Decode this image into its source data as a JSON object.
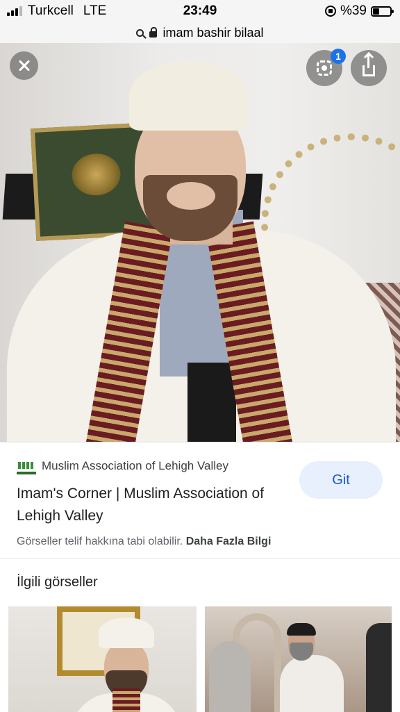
{
  "status_bar": {
    "carrier": "Turkcell",
    "network": "LTE",
    "time": "23:49",
    "battery": "%39",
    "icons": [
      "signal-icon",
      "orientation-lock-icon",
      "battery-icon"
    ]
  },
  "url_bar": {
    "query": "imam bashir bilaal",
    "icons": [
      "search-icon",
      "lock-icon"
    ]
  },
  "image_viewer": {
    "lens_badge_count": "1",
    "icons": [
      "close-icon",
      "lens-icon",
      "share-icon"
    ]
  },
  "result": {
    "source_name": "Muslim Association of Lehigh Valley",
    "title": "Imam's Corner | Muslim Association of Lehigh Valley",
    "visit_button": "Git",
    "copyright_notice": "Görseller telif hakkına tabi olabilir.",
    "learn_more": "Daha Fazla Bilgi",
    "accent_color": "#1a57c4"
  },
  "related": {
    "heading": "İlgili görseller"
  }
}
